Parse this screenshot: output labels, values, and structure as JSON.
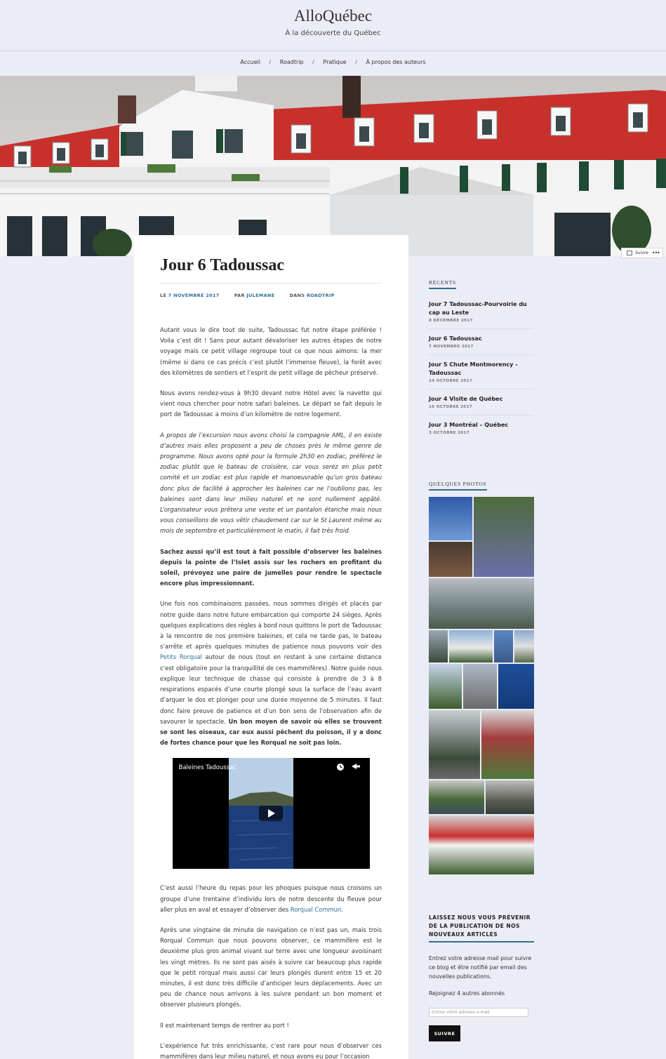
{
  "site": {
    "title": "AlloQuébec",
    "description": "À la découverte du Québec"
  },
  "nav": {
    "items": [
      {
        "label": "Accueil"
      },
      {
        "label": "Roadtrip"
      },
      {
        "label": "Pratique"
      },
      {
        "label": "À propos des auteurs"
      }
    ],
    "separator": "/"
  },
  "follow_button": {
    "label": "Suivre",
    "more": "•••"
  },
  "post": {
    "title": "Jour 6 Tadoussac",
    "meta": {
      "date_prefix": "LE",
      "date": "7 NOVEMBRE 2017",
      "author_prefix": "PAR",
      "author": "JULEMANE",
      "category_prefix": "DANS",
      "category": "ROADTRIP"
    },
    "p1": "Autant vous le dire tout de suite, Tadoussac fut notre étape préférée ! Voila c’est dit ! Sans pour autant dévaloriser les autres étapes de notre voyage mais ce petit village regroupe tout ce que nous aimons: la mer (même si dans ce cas précis c’est plutôt l’immense fleuve), la forêt avec des kilomètres de sentiers et l’esprit de petit village de pêcheur préservé.",
    "p2": "Nous avons rendez-vous à 9h30 devant notre Hôtel avec la navette qui vient nous chercher pour notre safari baleines. Le départ se fait depuis le port de Tadoussac a moins d’un kilomètre de notre logement.",
    "p3": "A propos de l’excursion nous avons choisi la compagnie AML, il en existe d’autres mais elles proposent a peu de choses près le même genre de programme. Nous avons opté pour la formule 2h30 en zodiac, préférez le zodiac plutôt que le bateau de croisière, car vous serez en plus petit comité et un zodiac est  plus rapide et manoeuvrable qu’un gros bateau donc plus de facilité à approcher les baleines car ne l’oublions pas,  les baleines sont dans leur milieu naturel et ne sont nullement appâté. L’organisateur vous prêtera une veste et un pantalon étanche mais nous vous conseillons de vous vêtir chaudement car sur le St Laurent même au mois de septembre et particulièrement le matin, il fait très froid.",
    "p4": "Sachez aussi qu’il est tout à fait possible d’observer les baleines depuis la pointe de l’Islet assis sur les rochers en profitant du soleil, prévoyez une paire de jumelles pour rendre le spectacle encore plus impressionnant.",
    "p5_a": "Une fois nos combinaisons passées, nous sommes dirigés et placés par notre guide dans notre future embarcation qui comporte 24 sièges. Après quelques explications des règles à bord nous quittons le port de Tadoussac à la rencontre de nos première baleines, et cela ne tarde pas, le bateau s’arrête et après quelques minutes de patience nous pouvons voir des ",
    "p5_link": "Petits Rorqual",
    "p5_b": " autour de nous (tout en restant à une certaine distance c’est obligatoire pour la tranquillité de ces mammifères). Notre guide nous explique leur technique de chasse qui consiste à prendre de 3 à 8 respirations espacés d’une courte plongé sous la surface de l’eau avant d’arquer le dos et plonger pour une durée moyenne de 5 minutes. Il faut donc faire preuve de patience et d’un bon sens de l’observation afin de savourer le spectacle. ",
    "p5_bold": "Un bon moyen de savoir où elles se trouvent se sont les oiseaux, car eux aussi pêchent du poisson, il y a donc de fortes chance pour que les Rorqual ne soit pas loin.",
    "video_title": "Baleines Tadoussac",
    "p6_a": "C’est aussi l’heure du repas pour les phoques puisque nous croisons un groupe d’une trentaine d’individu lors de notre descente du fleuve pour aller plus en aval et essayer d’observer des ",
    "p6_link": "Rorqual Commun.",
    "p7": "Après une vingtaine de minute de navigation ce n’est pas un, mais trois Rorqual Commun que nous pouvons observer, ce mammifère est le deuxième plus gros animal vivant sur terre avec une longueur avoisinant les vingt mètres. Ils ne sont pas aisés à suivre car beaucoup plus rapide que le petit rorqual mais aussi car leurs plongés durent entre 15 et 20 minutes, il est donc très difficile d’anticiper leurs déplacements. Avec un peu de chance nous arrivons à les suivre pendant un bon moment et observer plusieurs plongés.",
    "p8": "Il est maintenant temps de rentrer au port !",
    "p9": "L’expérience fut très enrichissante, c’est rare pour nous d’observer ces mammifères dans leur milieu naturel, et nous avons eu pour l’occasion"
  },
  "sidebar": {
    "recent_title": "RÉCENTS",
    "recent": [
      {
        "title": "Jour 7 Tadoussac-Pourvoirie du cap au Leste",
        "date": "8 DÉCEMBRE 2017"
      },
      {
        "title": "Jour 6 Tadoussac",
        "date": "7 NOVEMBRE 2017"
      },
      {
        "title": "Jour 5 Chute Montmorency – Tadoussac",
        "date": "24 OCTOBRE 2017"
      },
      {
        "title": "Jour 4 Visite de Québec",
        "date": "16 OCTOBRE 2017"
      },
      {
        "title": "Jour 3 Montréal – Québec",
        "date": "3 OCTOBRE 2017"
      }
    ],
    "photos_title": "QUELQUES PHOTOS",
    "subscribe_title": "LAISSEZ NOUS VOUS PRÉVENIR DE LA PUBLICATION DE NOS NOUVEAUX ARTICLES",
    "subscribe_text": "Entrez votre adresse mail pour suivre ce blog et être notifié par email des nouvelles publications.",
    "subscribers": "Rejoignez 4 autres abonnés",
    "email_placeholder": "Entrez votre adresse e-mail",
    "submit": "SUIVRE"
  },
  "colors": {
    "background": "#ebecf5",
    "accent": "#2e6f93",
    "roof": "#c8302c"
  }
}
